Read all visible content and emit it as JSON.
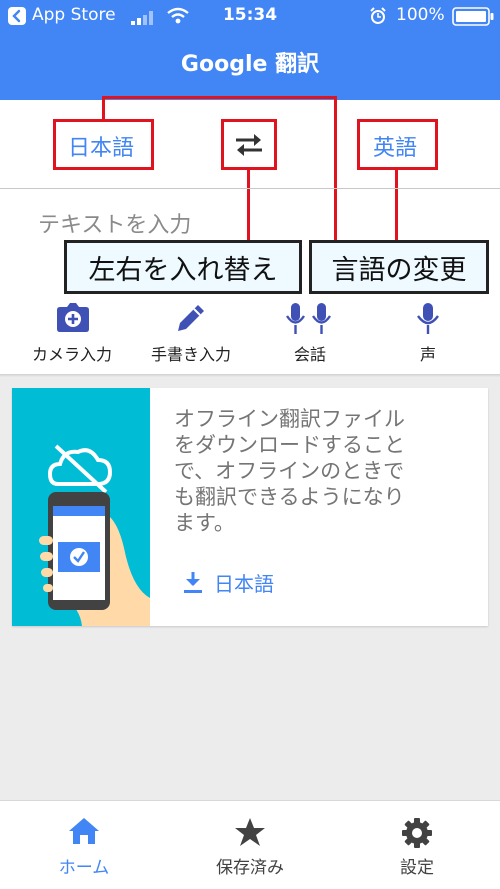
{
  "status_bar": {
    "back_app": "App Store",
    "time": "15:34",
    "battery": "100%"
  },
  "app_bar": {
    "title": "Google 翻訳"
  },
  "languages": {
    "source": "日本語",
    "target": "英語",
    "swap_icon": "swap-arrows-icon"
  },
  "annotations": {
    "swap_callout": "左右を入れ替え",
    "change_callout": "言語の変更"
  },
  "input": {
    "placeholder": "テキストを入力"
  },
  "tools": [
    {
      "label": "カメラ入力",
      "icon": "camera-icon"
    },
    {
      "label": "手書き入力",
      "icon": "pen-icon"
    },
    {
      "label": "会話",
      "icon": "double-mic-icon"
    },
    {
      "label": "声",
      "icon": "mic-icon"
    }
  ],
  "offline_card": {
    "lines": [
      "オフライン翻訳ファイル",
      "をダウンロードすること",
      "で、オフラインのときで",
      "も翻訳できるようになり",
      "ます。"
    ],
    "download_label": "日本語"
  },
  "bottom_nav": [
    {
      "label": "ホーム",
      "icon": "home-icon",
      "active": true
    },
    {
      "label": "保存済み",
      "icon": "star-icon",
      "active": false
    },
    {
      "label": "設定",
      "icon": "gear-icon",
      "active": false
    }
  ],
  "colors": {
    "brand_blue": "#4285f4",
    "annotation_red": "#e0141e",
    "illustration_cyan": "#00bcd4"
  }
}
